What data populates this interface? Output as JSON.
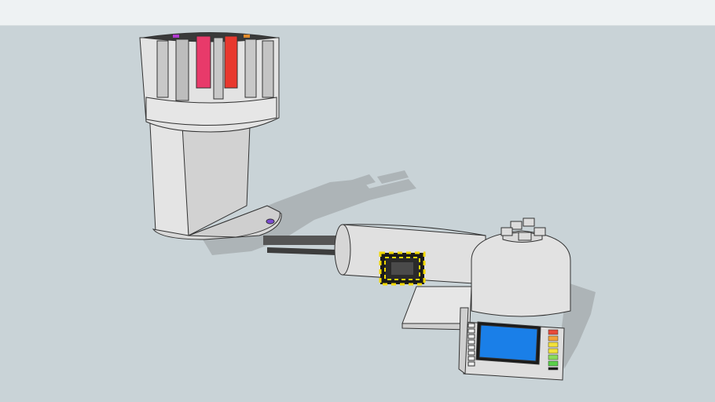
{
  "scene": {
    "background_color": "#c9d3d7",
    "topbar_color": "#eef2f3",
    "model_surface_color": "#e3e3e3",
    "edge_color": "#333333",
    "shadow_color": "#adb4b7",
    "screen_color": "#1a7fe8",
    "hazard_colors": [
      "#f2d900",
      "#1a1a1a"
    ],
    "carousel_slot_colors": [
      "#e83a6a",
      "#e8382e",
      "#b03ad0",
      "#e08a2a"
    ],
    "level_meter_colors": [
      "#e84a3a",
      "#f2a23a",
      "#f2e23a",
      "#5ad04a"
    ],
    "button_count": 8
  }
}
